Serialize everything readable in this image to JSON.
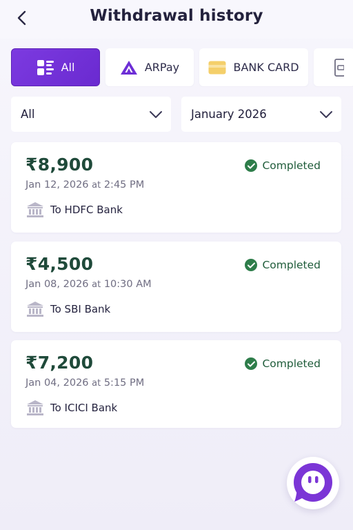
{
  "header": {
    "title": "Withdrawal history"
  },
  "tabs": [
    {
      "label": "All",
      "active": true,
      "icon": "grid-icon"
    },
    {
      "label": "ARPay",
      "active": false,
      "icon": "arpay-logo-icon"
    },
    {
      "label": "BANK CARD",
      "active": false,
      "icon": "card-icon"
    },
    {
      "label": "",
      "active": false,
      "icon": "wallet-icon"
    }
  ],
  "filters": {
    "type": {
      "value": "All"
    },
    "month": {
      "value": "January 2026"
    }
  },
  "withdrawals": [
    {
      "amount": "₹8,900",
      "status": "Completed",
      "date": "Jan 12, 2026",
      "at": "at",
      "time": "2:45 PM",
      "bank": "To HDFC Bank"
    },
    {
      "amount": "₹4,500",
      "status": "Completed",
      "date": "Jan 08, 2026",
      "at": "at",
      "time": "10:30 AM",
      "bank": "To SBI Bank"
    },
    {
      "amount": "₹7,200",
      "status": "Completed",
      "date": "Jan 04, 2026",
      "at": "at",
      "time": "5:15 PM",
      "bank": "To ICICI Bank"
    }
  ],
  "colors": {
    "accent": "#7c3ae0",
    "amount": "#1f4a3a",
    "status": "#2e7d4a",
    "card_tab": "#f4cf6a"
  }
}
